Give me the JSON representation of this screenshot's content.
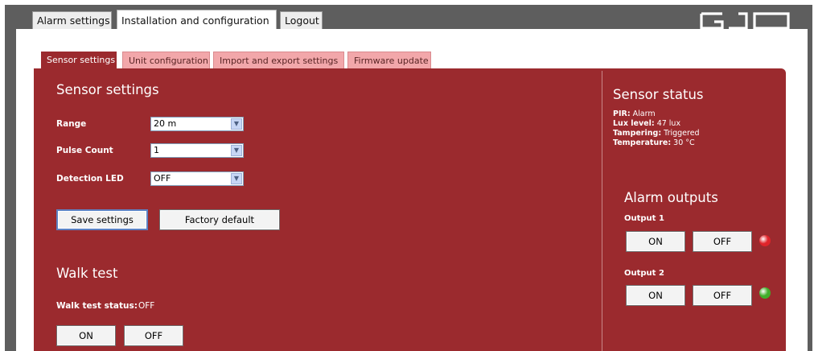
{
  "top_tabs": [
    "Alarm settings",
    "Installation and configuration",
    "Logout"
  ],
  "logo_text": "GJD",
  "sub_tabs": [
    "Sensor settings",
    "Unit configuration",
    "Import and export settings",
    "Firmware update"
  ],
  "sensor_settings": {
    "title": "Sensor settings",
    "fields": [
      {
        "label": "Range",
        "value": "20 m"
      },
      {
        "label": "Pulse Count",
        "value": "1"
      },
      {
        "label": "Detection LED",
        "value": "OFF"
      }
    ],
    "save_label": "Save settings",
    "factory_label": "Factory default"
  },
  "walk_test": {
    "title": "Walk test",
    "status_label": "Walk test status:",
    "status_value": "OFF",
    "on_label": "ON",
    "off_label": "OFF"
  },
  "sensor_status": {
    "title": "Sensor status",
    "items": [
      {
        "label": "PIR:",
        "value": "Alarm"
      },
      {
        "label": "Lux level:",
        "value": "47 lux"
      },
      {
        "label": "Tampering:",
        "value": "Triggered"
      },
      {
        "label": "Temperature:",
        "value": "30 °C"
      }
    ]
  },
  "alarm_outputs": {
    "title": "Alarm outputs",
    "outputs": [
      {
        "label": "Output 1",
        "on_label": "ON",
        "off_label": "OFF",
        "indicator_color": "#e0242a"
      },
      {
        "label": "Output 2",
        "on_label": "ON",
        "off_label": "OFF",
        "indicator_color": "#3fae2a"
      }
    ]
  },
  "colors": {
    "accent": "#9b2a2e",
    "tab_inactive": "#f2a7aa",
    "frame": "#5e5e5e"
  }
}
